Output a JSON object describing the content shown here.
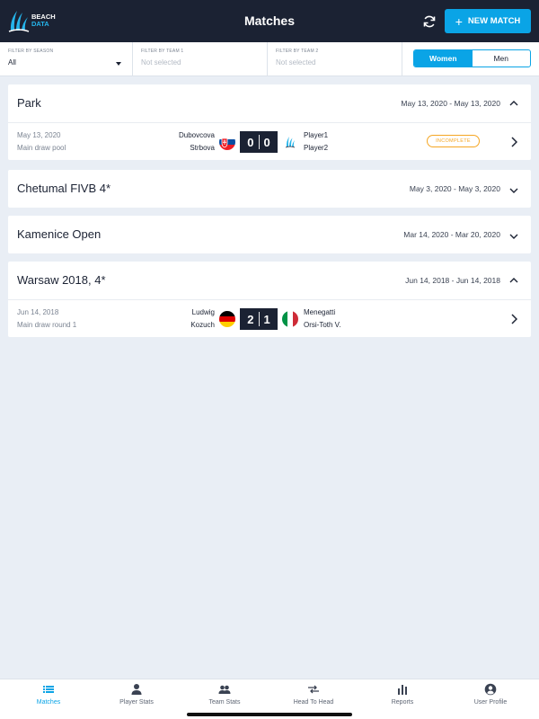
{
  "header": {
    "logo_line1": "BEACH",
    "logo_line2": "DATA",
    "title": "Matches",
    "refresh_icon": "refresh-icon",
    "new_match_label": "NEW MATCH",
    "accent": "#0aa4e6",
    "bg": "#1b2233"
  },
  "filters": {
    "season": {
      "label": "FILTER BY SEASON",
      "value": "All"
    },
    "team1": {
      "label": "FILTER BY TEAM 1",
      "placeholder": "Not selected"
    },
    "team2": {
      "label": "FILTER BY TEAM 2",
      "placeholder": "Not selected"
    },
    "gender": {
      "options": [
        "Women",
        "Men"
      ],
      "selected": "Women"
    }
  },
  "tournaments": [
    {
      "name": "Park",
      "dates": "May 13, 2020 - May 13, 2020",
      "expanded": true,
      "matches": [
        {
          "date": "May 13, 2020",
          "round": "Main draw pool",
          "team1": [
            "Dubovcova",
            "Strbova"
          ],
          "team1_flag": "slovakia-flag",
          "score": [
            "0",
            "0"
          ],
          "team2": [
            "Player1",
            "Player2"
          ],
          "team2_flag": "beach-data-logo",
          "status": "INCOMPLETE"
        }
      ]
    },
    {
      "name": "Chetumal FIVB 4*",
      "dates": "May 3, 2020 - May 3, 2020",
      "expanded": false
    },
    {
      "name": "Kamenice Open",
      "dates": "Mar 14, 2020 - Mar 20, 2020",
      "expanded": false
    },
    {
      "name": "Warsaw 2018, 4*",
      "dates": "Jun 14, 2018 - Jun 14, 2018",
      "expanded": true,
      "matches": [
        {
          "date": "Jun 14, 2018",
          "round": "Main draw round 1",
          "team1": [
            "Ludwig",
            "Kozuch"
          ],
          "team1_flag": "germany-flag",
          "score": [
            "2",
            "1"
          ],
          "team2": [
            "Menegatti",
            "Orsi-Toth V."
          ],
          "team2_flag": "italy-flag"
        }
      ]
    }
  ],
  "tabbar": [
    {
      "label": "Matches",
      "icon": "list-icon",
      "active": true
    },
    {
      "label": "Player Stats",
      "icon": "person-icon"
    },
    {
      "label": "Team Stats",
      "icon": "people-icon"
    },
    {
      "label": "Head To Head",
      "icon": "arrows-icon"
    },
    {
      "label": "Reports",
      "icon": "bar-chart-icon"
    },
    {
      "label": "User Profile",
      "icon": "user-circle-icon"
    }
  ]
}
